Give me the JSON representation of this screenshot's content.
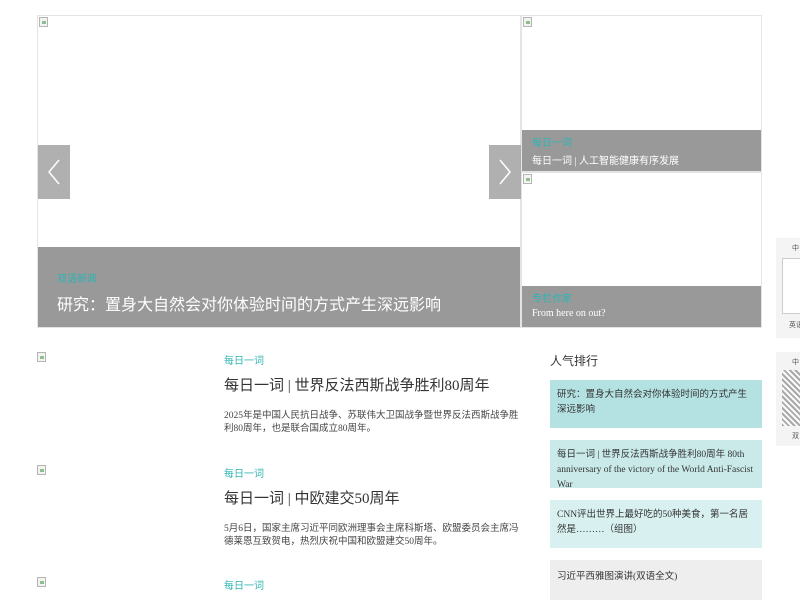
{
  "hero": {
    "main": {
      "category": "双语新闻",
      "title": "研究：置身大自然会对你体验时间的方式产生深远影响"
    },
    "side": [
      {
        "category": "每日一词",
        "title": "每日一词 | 人工智能健康有序发展"
      },
      {
        "category": "专栏作家",
        "title": "From here on out?"
      }
    ]
  },
  "articles": [
    {
      "category": "每日一词",
      "title": "每日一词 | 世界反法西斯战争胜利80周年",
      "desc": "2025年是中国人民抗日战争、苏联伟大卫国战争暨世界反法西斯战争胜利80周年，也是联合国成立80周年。"
    },
    {
      "category": "每日一词",
      "title": "每日一词 | 中欧建交50周年",
      "desc": "5月6日，国家主席习近平同欧洲理事会主席科斯塔、欧盟委员会主席冯德莱恩互致贺电，热烈庆祝中国和欧盟建交50周年。"
    },
    {
      "category": "每日一词"
    }
  ],
  "ranking": {
    "title": "人气排行",
    "items": [
      "研究：置身大自然会对你体验时间的方式产生深远影响",
      "每日一词 | 世界反法西斯战争胜利80周年 80th anniversary of the victory of the World Anti-Fascist War",
      "CNN评出世界上最好吃的50种美食，第一名居然是………（组图）",
      "习近平西雅图演讲(双语全文)"
    ]
  },
  "edge": {
    "widget1": {
      "top_label": "中",
      "bottom_label": "英语"
    },
    "widget2": {
      "top_label": "中",
      "bottom_label": "双"
    }
  },
  "icons": {
    "prev": "chevron-left-icon",
    "next": "chevron-right-icon",
    "image": "broken-image-icon"
  }
}
